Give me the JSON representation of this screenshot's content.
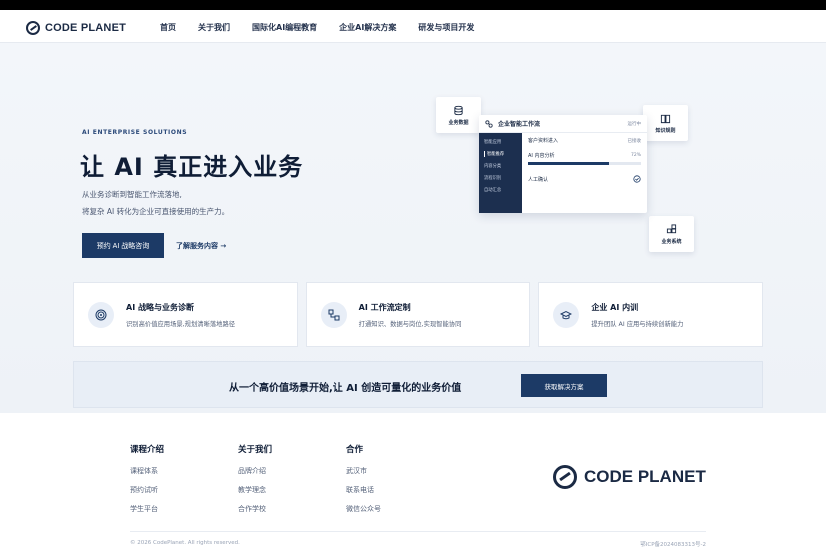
{
  "brand": {
    "name": "CODE PLANET"
  },
  "nav": [
    "首页",
    "关于我们",
    "国际化AI编程教育",
    "企业AI解决方案",
    "研发与项目开发"
  ],
  "hero": {
    "eyebrow": "AI ENTERPRISE SOLUTIONS",
    "title": "让 AI 真正进入业务",
    "sub1": "从业务诊断到智能工作流落地,",
    "sub2": "将复杂 AI 转化为企业可直接使用的生产力。",
    "primary_btn": "预约 AI 战略咨询",
    "secondary_link": "了解服务内容 →"
  },
  "floating_cards": {
    "data": "业务数据",
    "knowledge": "知识规则",
    "system": "业务系统"
  },
  "panel": {
    "title": "企业智能工作流",
    "status": "运行中",
    "side": [
      "智能应用",
      "智能推荐",
      "内容分类",
      "流程识别",
      "自动汇总"
    ],
    "rows": [
      {
        "label": "客户资料进入",
        "right": "已接收"
      },
      {
        "label": "AI 内容分析",
        "right": "72%"
      },
      {
        "label": "人工确认",
        "right": ""
      }
    ],
    "progress": 0.72
  },
  "features": [
    {
      "title": "AI 战略与业务诊断",
      "desc": "识别高价值应用场景,规划清晰落地路径",
      "icon": "target-icon"
    },
    {
      "title": "AI 工作流定制",
      "desc": "打通知识、数据与岗位,实现智能协同",
      "icon": "workflow-icon"
    },
    {
      "title": "企业 AI 内训",
      "desc": "提升团队 AI 应用与持续创新能力",
      "icon": "graduation-cap-icon"
    }
  ],
  "cta": {
    "text": "从一个高价值场景开始,让 AI 创造可量化的业务价值",
    "button": "获取解决方案"
  },
  "footer": {
    "cols": [
      {
        "title": "课程介绍",
        "items": [
          "课程体系",
          "预约试听",
          "学生平台"
        ]
      },
      {
        "title": "关于我们",
        "items": [
          "品牌介绍",
          "教学理念",
          "合作学校"
        ]
      },
      {
        "title": "合作",
        "items": [
          "武汉市",
          "联系电话",
          "微信公众号"
        ]
      }
    ],
    "copyright": "© 2026 CodePlanet. All rights reserved.",
    "icp": "鄂ICP备2024083313号-2"
  },
  "colors": {
    "primary": "#1c3a66",
    "dark": "#0f1d36"
  }
}
